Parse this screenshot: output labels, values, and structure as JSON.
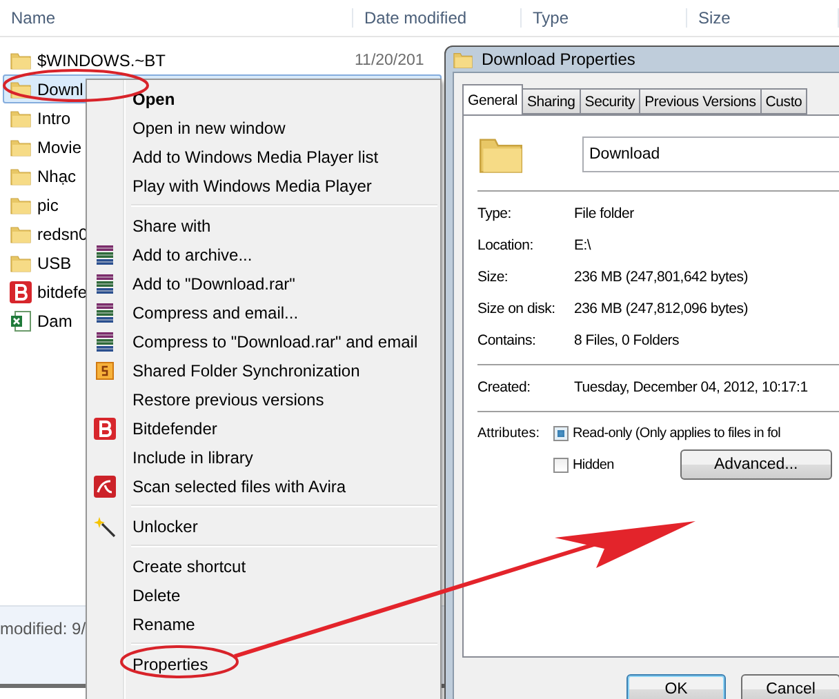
{
  "explorer": {
    "columns": [
      "Name",
      "Date modified",
      "Type",
      "Size"
    ],
    "rows": [
      {
        "kind": "folder",
        "name": "$WINDOWS.~BT",
        "date": "11/20/201",
        "selected": false
      },
      {
        "kind": "folder",
        "name": "Downl",
        "selected": true
      },
      {
        "kind": "folder",
        "name": "Intro",
        "selected": false
      },
      {
        "kind": "folder",
        "name": "Movie",
        "selected": false
      },
      {
        "kind": "folder",
        "name": "Nhạc",
        "selected": false
      },
      {
        "kind": "folder",
        "name": "pic",
        "selected": false
      },
      {
        "kind": "folder",
        "name": "redsn0",
        "selected": false
      },
      {
        "kind": "folder",
        "name": "USB",
        "selected": false
      },
      {
        "kind": "app",
        "name": "bitdefe",
        "selected": false
      },
      {
        "kind": "sheet",
        "name": "Dam",
        "selected": false
      }
    ],
    "status": "modified: 9/"
  },
  "context_menu": {
    "items": [
      {
        "kind": "plain",
        "label": "Open",
        "default": true
      },
      {
        "kind": "plain",
        "label": "Open in new window",
        "default": false
      },
      {
        "kind": "plain",
        "label": "Add to Windows Media Player list",
        "default": false
      },
      {
        "kind": "plain",
        "label": "Play with Windows Media Player",
        "default": false
      },
      {
        "kind": "separator"
      },
      {
        "kind": "plain",
        "label": "Share with",
        "default": false
      },
      {
        "kind": "archive",
        "label": "Add to archive...",
        "default": false
      },
      {
        "kind": "archive",
        "label": "Add to \"Download.rar\"",
        "default": false
      },
      {
        "kind": "archive",
        "label": "Compress and email...",
        "default": false
      },
      {
        "kind": "archive",
        "label": "Compress to \"Download.rar\" and email",
        "default": false
      },
      {
        "kind": "sync",
        "label": "Shared Folder Synchronization",
        "default": false
      },
      {
        "kind": "plain",
        "label": "Restore previous versions",
        "default": false
      },
      {
        "kind": "shield",
        "label": "Bitdefender",
        "default": false
      },
      {
        "kind": "plain",
        "label": "Include in library",
        "default": false
      },
      {
        "kind": "scan",
        "label": "Scan selected files with Avira",
        "default": false
      },
      {
        "kind": "separator"
      },
      {
        "kind": "wand",
        "label": "Unlocker",
        "default": false
      },
      {
        "kind": "separator"
      },
      {
        "kind": "plain",
        "label": "Create shortcut",
        "default": false
      },
      {
        "kind": "plain",
        "label": "Delete",
        "default": false
      },
      {
        "kind": "plain",
        "label": "Rename",
        "default": false
      },
      {
        "kind": "separator"
      },
      {
        "kind": "plain",
        "label": "Properties",
        "default": false
      }
    ]
  },
  "dialog": {
    "title": "Download Properties",
    "tabs": [
      {
        "label": "General",
        "selected": true
      },
      {
        "label": "Sharing",
        "selected": false
      },
      {
        "label": "Security",
        "selected": false
      },
      {
        "label": "Previous Versions",
        "selected": false
      },
      {
        "label": "Custo",
        "selected": false
      }
    ],
    "name_field": "Download",
    "groups": [
      [
        {
          "label": "Type:",
          "value": "File folder"
        },
        {
          "label": "Location:",
          "value": "E:\\"
        },
        {
          "label": "Size:",
          "value": "236 MB (247,801,642 bytes)"
        },
        {
          "label": "Size on disk:",
          "value": "236 MB (247,812,096 bytes)"
        },
        {
          "label": "Contains:",
          "value": "8 Files, 0 Folders"
        }
      ],
      [
        {
          "label": "Created:",
          "value": "Tuesday, December 04, 2012, 10:17:1"
        }
      ]
    ],
    "attributes_label": "Attributes:",
    "checkboxes": [
      {
        "label": "Read-only (Only applies to files in fol",
        "checked": true
      },
      {
        "label": "Hidden",
        "checked": false
      }
    ],
    "advanced_button": "Advanced...",
    "buttons": [
      {
        "label": "OK",
        "default": true
      },
      {
        "label": "Cancel",
        "default": false
      }
    ]
  }
}
